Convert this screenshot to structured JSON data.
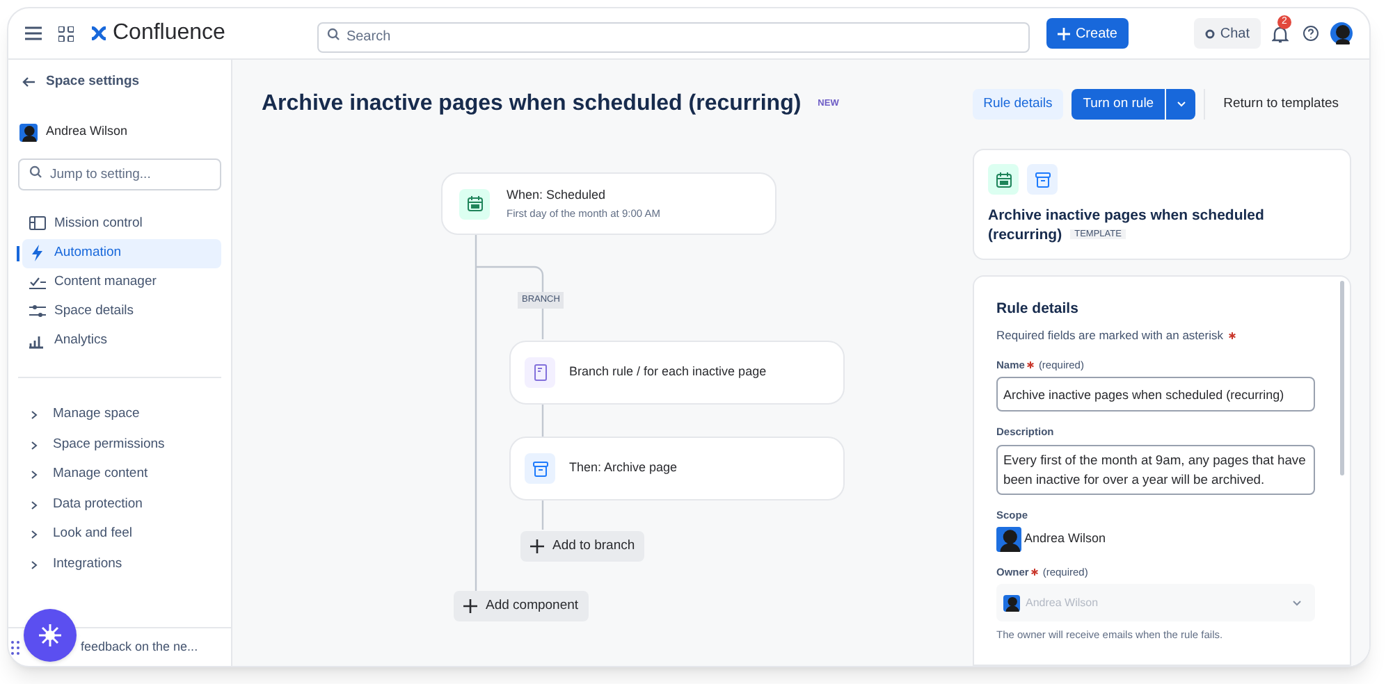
{
  "top_bar": {
    "product": "Confluence",
    "search": {
      "placeholder": "Search"
    },
    "create_button": "Create",
    "chat_button": "Chat",
    "notification_count": "2"
  },
  "sidebar": {
    "back_link": "Space settings",
    "space": "Andrea Wilson",
    "search": {
      "placeholder": "Jump to setting..."
    },
    "nav_items": [
      {
        "label": "Mission control",
        "selected": false
      },
      {
        "label": "Automation",
        "selected": true
      },
      {
        "label": "Content manager",
        "selected": false
      },
      {
        "label": "Space details",
        "selected": false
      },
      {
        "label": "Analytics",
        "selected": false
      }
    ],
    "sections": [
      {
        "label": "Manage space",
        "expanded": false
      },
      {
        "label": "Space permissions",
        "expanded": false
      },
      {
        "label": "Manage content",
        "expanded": false
      },
      {
        "label": "Data protection",
        "expanded": false
      },
      {
        "label": "Look and feel",
        "expanded": false
      },
      {
        "label": "Integrations",
        "expanded": false
      }
    ],
    "feedback": "feedback on the ne..."
  },
  "header": {
    "title": "Archive inactive pages when scheduled (recurring)",
    "badge": "NEW",
    "rule_details_button": "Rule details",
    "turn_on_button": "Turn on rule",
    "return_button": "Return to templates"
  },
  "flow": {
    "trigger": {
      "title": "When: Scheduled",
      "subtitle": "First day of the month at 9:00 AM"
    },
    "branch_label": "BRANCH",
    "branch_steps": [
      {
        "kind": "branch",
        "label": "Branch rule / for each inactive page"
      },
      {
        "kind": "action",
        "label": "Then: Archive page"
      }
    ],
    "add_to_branch": "Add to branch",
    "add_component": "Add component"
  },
  "summary_card": {
    "title": "Archive inactive pages when scheduled (recurring)",
    "badge": "TEMPLATE"
  },
  "rule_details": {
    "heading": "Rule details",
    "required_note": "Required fields are marked with an asterisk",
    "fields": [
      {
        "kind": "text",
        "label": "Name",
        "required": true,
        "hint": "(required)",
        "value": "Archive inactive pages when scheduled (recurring)"
      },
      {
        "kind": "textarea",
        "label": "Description",
        "required": false,
        "value": "Every first of the month at 9am, any pages that have been inactive for over a year will be archived."
      },
      {
        "kind": "user",
        "label": "Scope",
        "required": false,
        "value": "Andrea Wilson"
      },
      {
        "kind": "select",
        "label": "Owner",
        "required": true,
        "hint": "(required)",
        "value": "Andrea Wilson",
        "disabled": true,
        "help": "The owner will receive emails when the rule fails."
      }
    ]
  }
}
